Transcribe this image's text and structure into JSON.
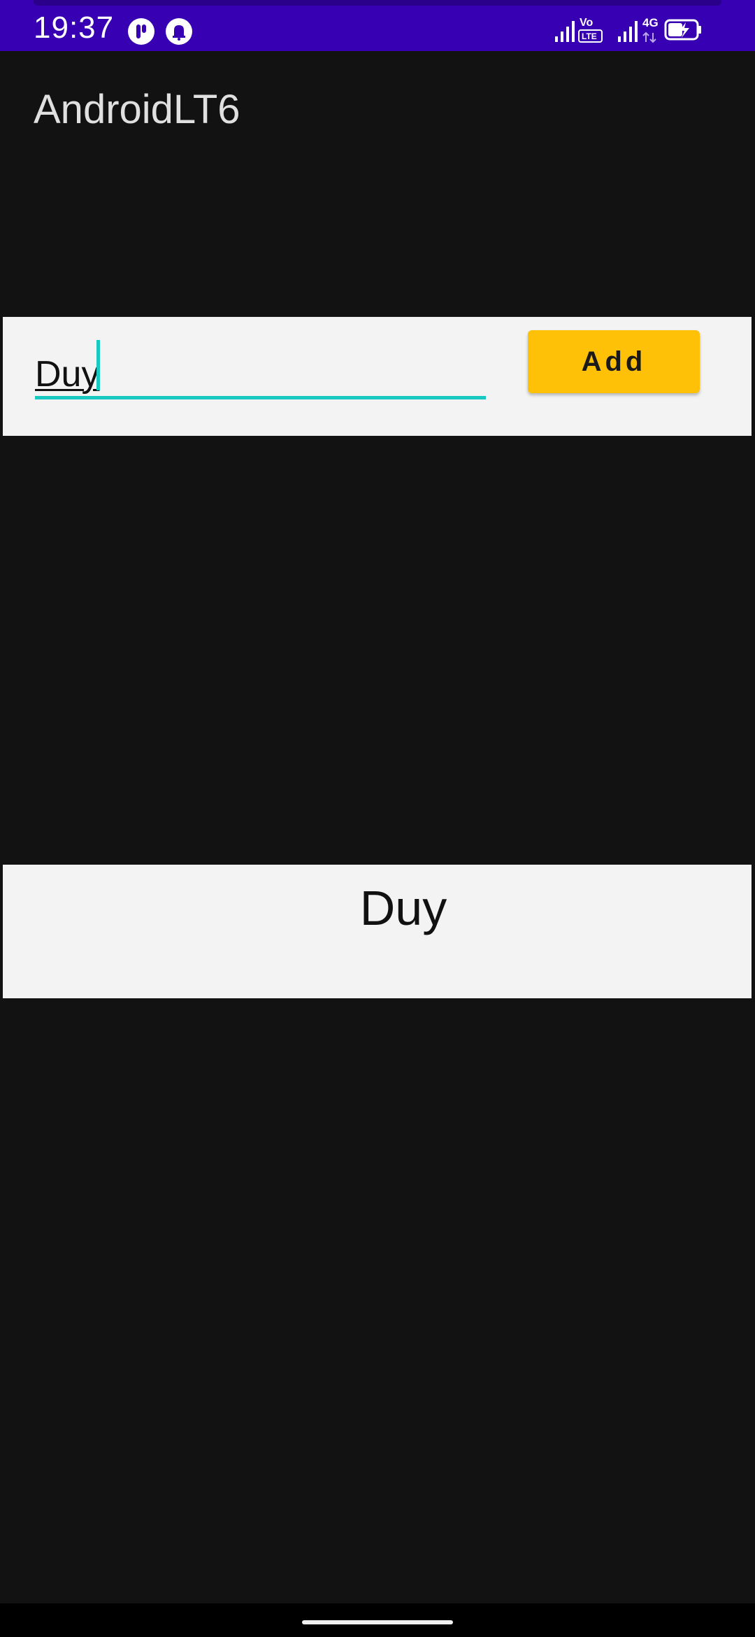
{
  "status_bar": {
    "time": "19:37",
    "background_color": "#3700b3",
    "left_icons": [
      "app-notification-icon",
      "notification-bell-icon"
    ],
    "right_icons": [
      "signal-icon",
      "volte-lte-icon",
      "signal-icon",
      "4g-data-icon",
      "battery-charging-icon"
    ],
    "volte_label": "Vo",
    "lte_label": "LTE",
    "network_label": "4G"
  },
  "app_bar": {
    "title": "AndroidLT6"
  },
  "input_form": {
    "name_value": "Duy",
    "add_label": "Add",
    "accent_color": "#17c9c0",
    "button_color": "#ffc107"
  },
  "list": {
    "items": [
      {
        "label": "Duy"
      }
    ]
  }
}
